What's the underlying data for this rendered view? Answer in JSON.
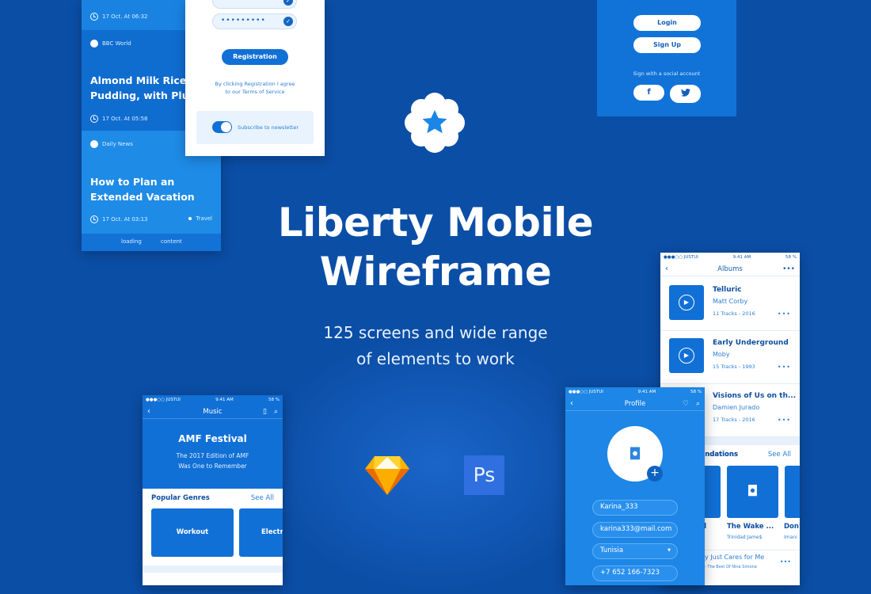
{
  "hero": {
    "title_line1": "Liberty Mobile",
    "title_line2": "Wireframe",
    "subtitle_line1": "125 screens and wide range",
    "subtitle_line2": "of elements to work",
    "badge_icon": "star-icon"
  },
  "colors": {
    "background": "#0b4ea6",
    "primary": "#1170d6",
    "sketch": "#fdb300",
    "photoshop": "#2f6fe0"
  },
  "news": {
    "items": [
      {
        "time": "17 Oct. At 06:32"
      },
      {
        "source": "BBC World",
        "title_line1": "Almond Milk Rice",
        "title_line2": "Pudding, with Plum",
        "time": "17 Oct. At 05:58"
      },
      {
        "source": "Daily News",
        "title_line1": "How to Plan an",
        "title_line2": "Extended Vacation",
        "time": "17 Oct. At 03:13",
        "tag": "Travel"
      }
    ],
    "footer_left": "loading",
    "footer_right": "content"
  },
  "registration": {
    "password_mask": "•••••••••",
    "button": "Registration",
    "terms_line1": "By clicking Registration I agree",
    "terms_line2": "to our Terms of Service",
    "newsletter": "Subscribe to newsletter",
    "newsletter_on": true
  },
  "login": {
    "login": "Login",
    "signup": "Sign Up",
    "social": "Sign with a social account",
    "facebook": "f",
    "twitter": "twitter-icon"
  },
  "status": {
    "carrier": "●●●○○ JUSTUI",
    "time": "9:41 AM",
    "battery": "58 %"
  },
  "music": {
    "title": "Music",
    "hero_title": "AMF Festival",
    "hero_line1": "The 2017 Edition of AMF",
    "hero_line2": "Was One to Remember",
    "section": "Popular Genres",
    "see_all": "See All",
    "genres": [
      "Workout",
      "Electro"
    ]
  },
  "tools": {
    "photoshop": "Ps"
  },
  "albums": {
    "title": "Albums",
    "items": [
      {
        "title": "Telluric",
        "artist": "Matt Corby",
        "meta": "11 Tracks - 2016"
      },
      {
        "title": "Early Underground",
        "artist": "Moby",
        "meta": "15 Tracks - 1993"
      },
      {
        "title": "Visions of Us on th...",
        "artist": "Damien Jurado",
        "meta": "17 Tracks - 2016"
      }
    ],
    "section": "Recommendations",
    "section_visible": "ndations",
    "see_all": "See All",
    "recs": [
      {
        "title": "d",
        "artist": ""
      },
      {
        "title": "The Wake ...",
        "artist": "Trinidad Jame$"
      },
      {
        "title": "Don'",
        "artist": "Imani"
      }
    ],
    "song": {
      "title": "y Just Cares for Me",
      "sub": "- The Best Of Nina Simone"
    }
  },
  "profile": {
    "title": "Profile",
    "username": "Karina_333",
    "email": "karina333@mail.com",
    "country": "Tunisia",
    "phone": "+7 652 166-7323"
  }
}
